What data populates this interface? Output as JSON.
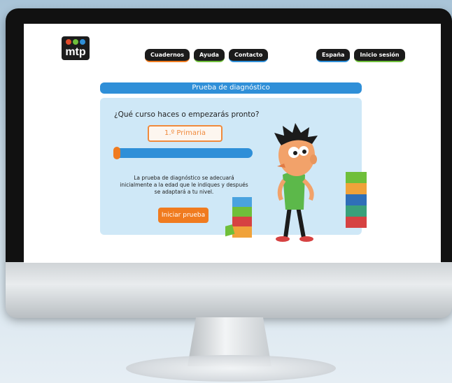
{
  "brand": {
    "logo_text": "mtp"
  },
  "nav": {
    "left": [
      "Cuadernos",
      "Ayuda",
      "Contacto"
    ],
    "right": [
      "España",
      "Inicio sesión"
    ]
  },
  "diagnostic": {
    "banner_title": "Prueba de diagnóstico",
    "question": "¿Qué curso haces o empezarás pronto?",
    "selected_grade": "1.º Primaria",
    "slider_level_percent": 0,
    "info_line1": "La prueba de diagnóstico se adecuará",
    "info_line2": "inicialmente a la edad que le indiques y después",
    "info_line3": "se adaptará a tu nivel.",
    "start_button": "Iniciar prueba"
  },
  "colors": {
    "accent_orange": "#f07b1f",
    "accent_blue": "#2f8fd8",
    "panel_bg": "#cfe8f7"
  }
}
